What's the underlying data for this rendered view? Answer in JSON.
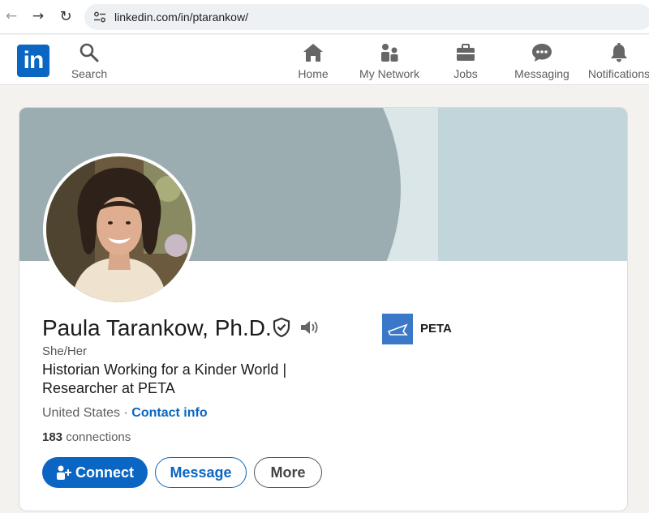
{
  "browser": {
    "url": "linkedin.com/in/ptarankow/",
    "back_icon": "←",
    "forward_icon": "→",
    "reload_icon": "↻"
  },
  "nav": {
    "logo": "in",
    "items": [
      {
        "label": "Search",
        "icon": "search-icon"
      },
      {
        "label": "Home",
        "icon": "home-icon"
      },
      {
        "label": "My Network",
        "icon": "network-icon"
      },
      {
        "label": "Jobs",
        "icon": "briefcase-icon"
      },
      {
        "label": "Messaging",
        "icon": "chat-icon"
      },
      {
        "label": "Notifications",
        "icon": "bell-icon"
      }
    ]
  },
  "profile": {
    "name": "Paula Tarankow, Ph.D.",
    "pronouns": "She/Her",
    "headline": "Historian Working for a Kinder World | Researcher at PETA",
    "location": "United States",
    "separator": " · ",
    "contact_label": "Contact info",
    "connections_count": "183",
    "connections_label": " connections",
    "company": {
      "name": "PETA",
      "logo_text": "PETA"
    }
  },
  "actions": {
    "connect": "Connect",
    "message": "Message",
    "more": "More"
  },
  "colors": {
    "accent": "#0a66c2",
    "banner_light": "#c2d5da",
    "banner_dark": "#9cadb1"
  }
}
